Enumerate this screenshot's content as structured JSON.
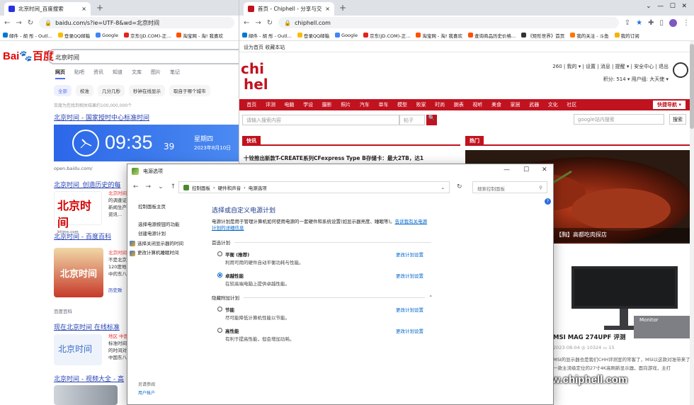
{
  "left_browser": {
    "tab": {
      "title": "北京时间_百度搜索",
      "close": "×"
    },
    "new_tab": "+",
    "url": "baidu.com/s?ie=UTF-8&wd=北京时间",
    "bookmarks": [
      "邮件 - 胡 彤 - Outl...",
      "登录QQ邮箱",
      "Google",
      "京东(JD.COM)-正...",
      "淘宝网 - 淘! 我喜欢"
    ],
    "bookmark_colors": [
      "#0078d4",
      "#fbbc04",
      "#4285f4",
      "#e1251b",
      "#ff5000"
    ],
    "search": {
      "logo_text": "Bai",
      "logo_text2": "百度",
      "value": "北京时间"
    },
    "tabs": [
      "网页",
      "贴吧",
      "资讯",
      "知道",
      "文库",
      "图片",
      "笔记"
    ],
    "filters": [
      "全部",
      "校准",
      "几分几秒",
      "秒钟在线显示",
      "取自于哪个城市"
    ],
    "count": "百度为您找到相关结果约100,000,000个",
    "result1": {
      "title": "北京时间 - 国家授时中心标准时间",
      "time": "09:35",
      "sec": "39",
      "week": "星期四",
      "date": "2023年8月10日",
      "source": "open.baidu.com/"
    },
    "result2": {
      "title": "北京时间_创造历史的每",
      "logo": "北京时间",
      "logo_sub": "btime.com",
      "snip": [
        "北京时间",
        "的调查证",
        "新闻生产",
        "资讯..."
      ]
    },
    "result3": {
      "title": "北京时间 - 百度百科",
      "snip": [
        "北京时间",
        "不是北京",
        "120度地",
        "中的东八"
      ],
      "more": "历史致",
      "source": "百度百科"
    },
    "result4": {
      "title": "现在北京时间 在线标准",
      "logo": "北京时间",
      "snip": [
        "地区 中国",
        "标准时间",
        "的时间对",
        "中国东八"
      ]
    },
    "result5": {
      "title": "北京时间 - 视频大全 - 高"
    }
  },
  "right_browser": {
    "tab": {
      "title": "首页 - Chiphell - 分享与交流用...",
      "close": "×"
    },
    "new_tab": "+",
    "url": "chiphell.com",
    "bookmarks": [
      "邮件 - 胡 彤 - Outl...",
      "登录QQ邮箱",
      "Google",
      "京东(JD.COM)-正...",
      "淘宝网 - 淘! 我喜欢",
      "查询商品历史价格...",
      "《矩形世界》首页",
      "我的关注 - 斗鱼",
      "我的订阅"
    ],
    "bookmark_colors": [
      "#0078d4",
      "#fbbc04",
      "#4285f4",
      "#e1251b",
      "#ff5000",
      "#ff5000",
      "#333333",
      "#ff7700",
      "#f4b400"
    ],
    "top_links": "设为首页  收藏本站",
    "user": "260 | 我的 ▾ | 设置 | 消息 | 提醒 ▾ | 安全中心 | 退出",
    "user2": "积分: 514 ▾     用户组: 大天使 ▾",
    "nav": [
      "首页",
      "评测",
      "电脑",
      "学设",
      "摄影",
      "照片",
      "汽车",
      "单车",
      "模型",
      "败家",
      "时尚",
      "腕表",
      "视听",
      "美食",
      "家居",
      "武器",
      "文化",
      "社区"
    ],
    "quick_nav": "快捷导航 ▾",
    "search_placeholder": "请输入搜索内容",
    "search_select": "帖子",
    "search_btn": "🔍",
    "google_placeholder": "google站内搜索",
    "google_btn": "搜索",
    "section1": "快讯",
    "section2": "热门",
    "news": "十铨推出新款T-CREATE系列CFexpress Type B存储卡：最大2TB，达1",
    "steak_caption": "【胸】高都吃肉探店",
    "review_title": "MSI MAG 274UPF 评测",
    "review_meta": "2023-08-04   ◎ 10324   ▭ 15",
    "review_desc": "MSI的显示器也是我们CHH评测室的常客了，MSI以这款对准带来了一款主流级定位的27寸4K高刷新显示器，面向游戏，主打",
    "watermark": "www.chiphell.com",
    "monitor_label": "Monitor",
    "accent": "#c1121f"
  },
  "dialog": {
    "title": "电源选项",
    "controls": [
      "—",
      "☐",
      "✕"
    ],
    "path": [
      "控制面板",
      "硬件和声音",
      "电源选项"
    ],
    "search_placeholder": "搜索控制面板",
    "left_links": [
      "控制面板主页",
      "选择电源按钮的功能",
      "创建电源计划",
      "选择关闭显示器的时间",
      "更改计算机睡眠时间"
    ],
    "heading": "选择或自定义电源计划",
    "intro": "电源计划是用于管理计算机如何使用电源的一套硬件和系统设置(如显示器亮度、睡眠等)。",
    "intro_link": "告诉我有关电源计划的详细信息",
    "preferred_label": "首选计划",
    "hidden_label": "隐藏附加计划",
    "plans": [
      {
        "name": "平衡 (推荐)",
        "desc": "利用可用的硬件自动平衡功耗与性能。",
        "change": "更改计划设置",
        "selected": false
      },
      {
        "name": "卓越性能",
        "desc": "在较高端电脑上提供卓越性能。",
        "change": "更改计划设置",
        "selected": true
      },
      {
        "name": "节能",
        "desc": "尽可能降低计算机性能以节能。",
        "change": "更改计划设置",
        "selected": false
      },
      {
        "name": "高性能",
        "desc": "有利于提高性能，但会增加功耗。",
        "change": "更改计划设置",
        "selected": false
      }
    ],
    "see_also": "另请参阅",
    "user_accounts": "用户帐户"
  }
}
